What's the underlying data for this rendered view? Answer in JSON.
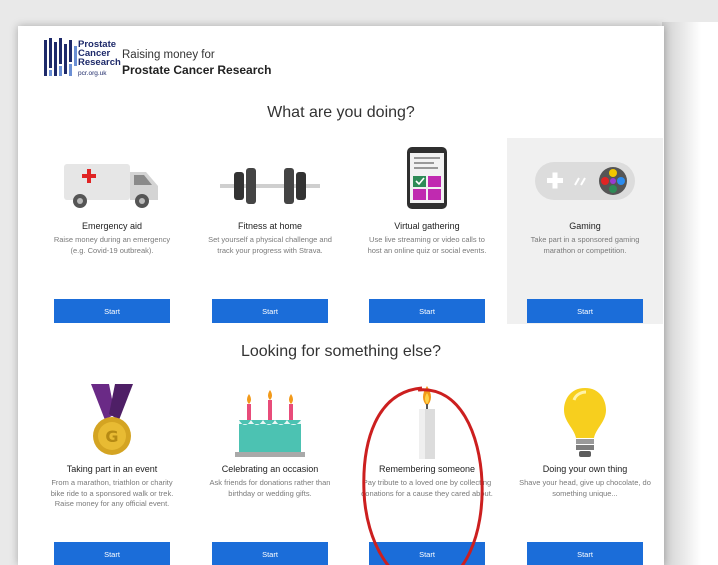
{
  "header": {
    "logo_lines": [
      "Prostate",
      "Cancer",
      "Research"
    ],
    "logo_url": "pcr.org.uk",
    "raising_line": "Raising money for",
    "charity_name": "Prostate Cancer Research"
  },
  "section_primary": {
    "title": "What are you doing?",
    "cards": [
      {
        "name": "Emergency aid",
        "desc": "Raise money during an emergency (e.g. Covid-19 outbreak).",
        "button": "Start",
        "icon": "ambulance-icon"
      },
      {
        "name": "Fitness at home",
        "desc": "Set yourself a physical challenge and track your progress with Strava.",
        "button": "Start",
        "icon": "dumbbell-icon"
      },
      {
        "name": "Virtual gathering",
        "desc": "Use live streaming or video calls to host an online quiz or social events.",
        "button": "Start",
        "icon": "smartphone-icon"
      },
      {
        "name": "Gaming",
        "desc": "Take part in a sponsored gaming marathon or competition.",
        "button": "Start",
        "icon": "gamepad-icon"
      }
    ]
  },
  "section_secondary": {
    "title": "Looking for something else?",
    "cards": [
      {
        "name": "Taking part in an event",
        "desc": "From a marathon, triathlon or charity bike ride to a sponsored walk or trek. Raise money for any official event.",
        "button": "Start",
        "icon": "medal-icon"
      },
      {
        "name": "Celebrating an occasion",
        "desc": "Ask friends for donations rather than birthday or wedding gifts.",
        "button": "Start",
        "icon": "birthday-cake-icon"
      },
      {
        "name": "Remembering someone",
        "desc": "Pay tribute to a loved one by collecting donations for a cause they cared about.",
        "button": "Start",
        "icon": "candle-icon"
      },
      {
        "name": "Doing your own thing",
        "desc": "Shave your head, give up chocolate, do something unique...",
        "button": "Start",
        "icon": "light-bulb-icon"
      }
    ]
  },
  "colors": {
    "button_bg": "#1b6dd9",
    "annotation": "#cc1f1f",
    "highlight_card": "#f0f0f0"
  }
}
